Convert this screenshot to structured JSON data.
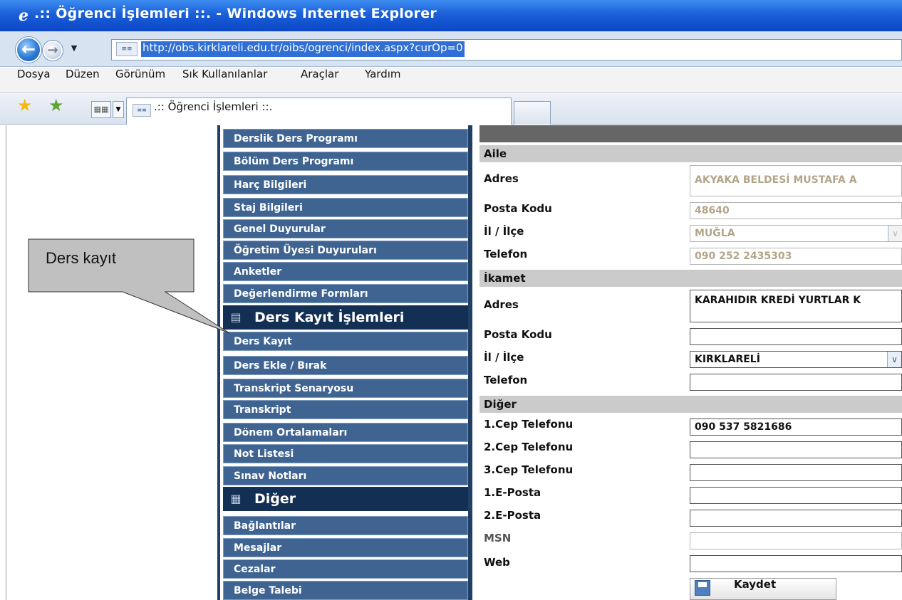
{
  "window": {
    "title": ".:: Öğrenci İşlemleri ::. - Windows Internet Explorer"
  },
  "address_bar": {
    "url": "http://obs.kirklareli.edu.tr/oibs/ogrenci/index.aspx?curOp=0"
  },
  "menu": {
    "items": [
      "Dosya",
      "Düzen",
      "Görünüm",
      "Sık Kullanılanlar",
      "Araçlar",
      "Yardım"
    ]
  },
  "tab": {
    "label": ".:: Öğrenci İşlemleri ::."
  },
  "sidebar": {
    "items_top": [
      "Derslik Ders Programı",
      "Bölüm Ders Programı",
      "Harç Bilgileri",
      "Staj Bilgileri",
      "Genel Duyurular",
      "Öğretim Üyesi Duyuruları",
      "Anketler",
      "Değerlendirme Formları"
    ],
    "section_ders": "Ders Kayıt İşlemleri",
    "items_ders": [
      "Ders Kayıt",
      "Ders Ekle / Bırak",
      "Transkript Senaryosu",
      "Transkript",
      "Dönem Ortalamaları",
      "Not Listesi",
      "Sınav Notları"
    ],
    "section_diger": "Diğer",
    "items_diger": [
      "Bağlantılar",
      "Mesajlar",
      "Cezalar",
      "Belge Talebi"
    ]
  },
  "form": {
    "aile": {
      "section": "Aile",
      "adres_label": "Adres",
      "adres_value": "AKYAKA BELDESİ MUSTAFA A",
      "posta_label": "Posta Kodu",
      "posta_value": "48640",
      "il_label": "İl / İlçe",
      "il_value": "MUĞLA",
      "tel_label": "Telefon",
      "tel_value": "090 252 2435303"
    },
    "ikamet": {
      "section": "İkamet",
      "adres_label": "Adres",
      "adres_value": "KARAHIDIR KREDİ YURTLAR K",
      "posta_label": "Posta Kodu",
      "posta_value": "",
      "il_label": "İl / İlçe",
      "il_value": "KIRKLARELİ",
      "tel_label": "Telefon",
      "tel_value": ""
    },
    "diger": {
      "section": "Diğer",
      "cep1_label": "1.Cep Telefonu",
      "cep1_value": "090 537 5821686",
      "cep2_label": "2.Cep Telefonu",
      "cep3_label": "3.Cep Telefonu",
      "eposta1_label": "1.E-Posta",
      "eposta2_label": "2.E-Posta",
      "msn_label": "MSN",
      "web_label": "Web"
    },
    "save_label": "Kaydet"
  },
  "annotation": {
    "callout_text": "Ders kayıt"
  }
}
